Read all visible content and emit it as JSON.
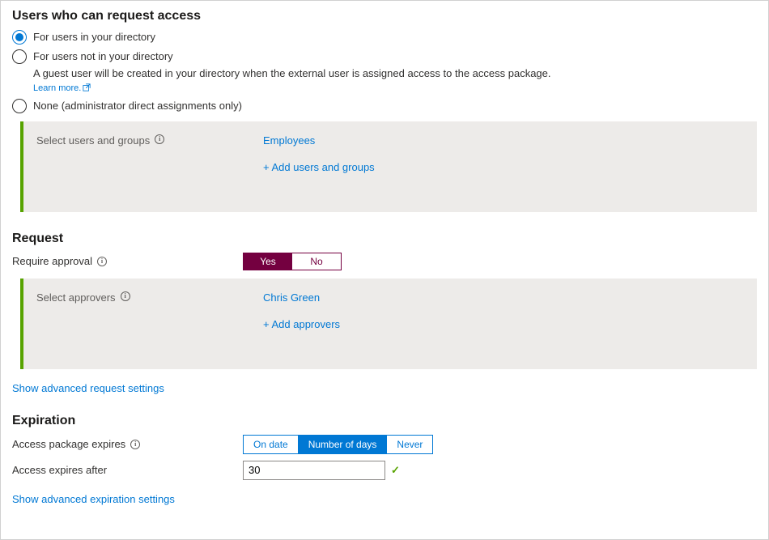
{
  "usersSection": {
    "heading": "Users who can request access",
    "options": [
      {
        "label": "For users in your directory",
        "selected": true
      },
      {
        "label": "For users not in your directory",
        "selected": false,
        "desc": "A guest user will be created in your directory when the external user is assigned access to the access package.",
        "learnMore": "Learn more."
      },
      {
        "label": "None (administrator direct assignments only)",
        "selected": false
      }
    ],
    "panel": {
      "label": "Select users and groups",
      "items": [
        "Employees"
      ],
      "addAction": "+ Add users and groups"
    }
  },
  "requestSection": {
    "heading": "Request",
    "approvalLabel": "Require approval",
    "toggle": {
      "yes": "Yes",
      "no": "No",
      "selected": "yes"
    },
    "panel": {
      "label": "Select approvers",
      "items": [
        "Chris Green"
      ],
      "addAction": "+ Add approvers"
    },
    "advancedLink": "Show advanced request settings"
  },
  "expirationSection": {
    "heading": "Expiration",
    "packageExpiresLabel": "Access package expires",
    "segments": [
      {
        "label": "On date",
        "selected": false
      },
      {
        "label": "Number of days",
        "selected": true
      },
      {
        "label": "Never",
        "selected": false
      }
    ],
    "expiresAfterLabel": "Access expires after",
    "expiresAfterValue": "30",
    "advancedLink": "Show advanced expiration settings"
  }
}
